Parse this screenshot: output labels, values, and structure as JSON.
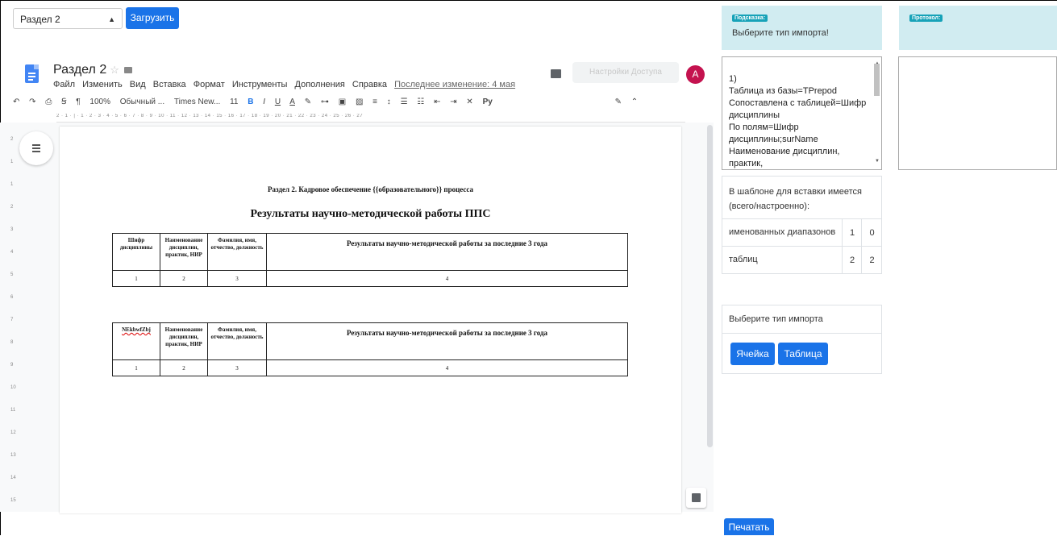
{
  "top": {
    "section_select": "Раздел 2",
    "load_button": "Загрузить"
  },
  "docs": {
    "title": "Раздел 2",
    "menu": [
      "Файл",
      "Изменить",
      "Вид",
      "Вставка",
      "Формат",
      "Инструменты",
      "Дополнения",
      "Справка"
    ],
    "last_edit": "Последнее изменение: 4 мая",
    "share_button": "Настройки Доступа",
    "avatar_letter": "A",
    "toolbar": {
      "zoom": "100%",
      "style": "Обычный ...",
      "font": "Times New...",
      "size": "11",
      "bold": "B",
      "italic": "I",
      "underline": "U",
      "text_color": "A",
      "input_tools": "Py"
    },
    "ruler": "2 · 1 · | · 1 · 2 · 3 · 4 · 5 · 6 · 7 · 8 · 9 · 10 · 11 · 12 · 13 · 14 · 15 · 16 · 17 · 18 · 19 · 20 · 21 · 22 · 23 · 24 · 25 · 26 · 27",
    "v_ruler": [
      "2",
      "1",
      "1",
      "2",
      "3",
      "4",
      "5",
      "6",
      "7",
      "8",
      "9",
      "10",
      "11",
      "12",
      "13",
      "14",
      "15"
    ]
  },
  "document": {
    "section_title": "Раздел 2. Кадровое обеспечение {{образовательного}} процесса",
    "subtitle": "Результаты научно-методической работы  ППС",
    "table1": {
      "headers": [
        "Шифр дисциплины",
        "Наименование дисциплин, практик, НИР",
        "Фамилия, имя, отчество, должность",
        "Результаты научно-методической работы за последние 3 года"
      ],
      "numbers": [
        "1",
        "2",
        "3",
        "4"
      ]
    },
    "table2": {
      "headers": [
        "NЕkbwfZbj",
        "Наименование дисциплин, практик, НИР",
        "Фамилия, имя, отчество, должность",
        "Результаты научно-методической работы за последние 3 года"
      ],
      "numbers": [
        "1",
        "2",
        "3",
        "4"
      ]
    }
  },
  "hint": {
    "badge": "Подсказка:",
    "text": "Выберите тип импорта!"
  },
  "protocol": {
    "badge": "Протокол:"
  },
  "log": {
    "lines": [
      "1)",
      "Таблица из базы=TPrepod",
      "Сопоставлена с таблицей=Шифр дисциплины",
      "По полям=Шифр дисциплины;surName",
      "Наименование дисциплин, практик,"
    ]
  },
  "template": {
    "heading": "В шаблоне для вставки имеется (всего/настроенно):",
    "rows": [
      {
        "label": "именованных диапазонов",
        "total": "1",
        "configured": "0"
      },
      {
        "label": "таблиц",
        "total": "2",
        "configured": "2"
      }
    ]
  },
  "import": {
    "label": "Выберите тип импорта",
    "cell_button": "Ячейка",
    "table_button": "Таблица"
  },
  "print_button": "Печатать",
  "colors": {
    "primary": "#1a73e8",
    "info_bg": "#d1ecf1",
    "badge": "#17a2b8",
    "avatar": "#c4124f"
  }
}
